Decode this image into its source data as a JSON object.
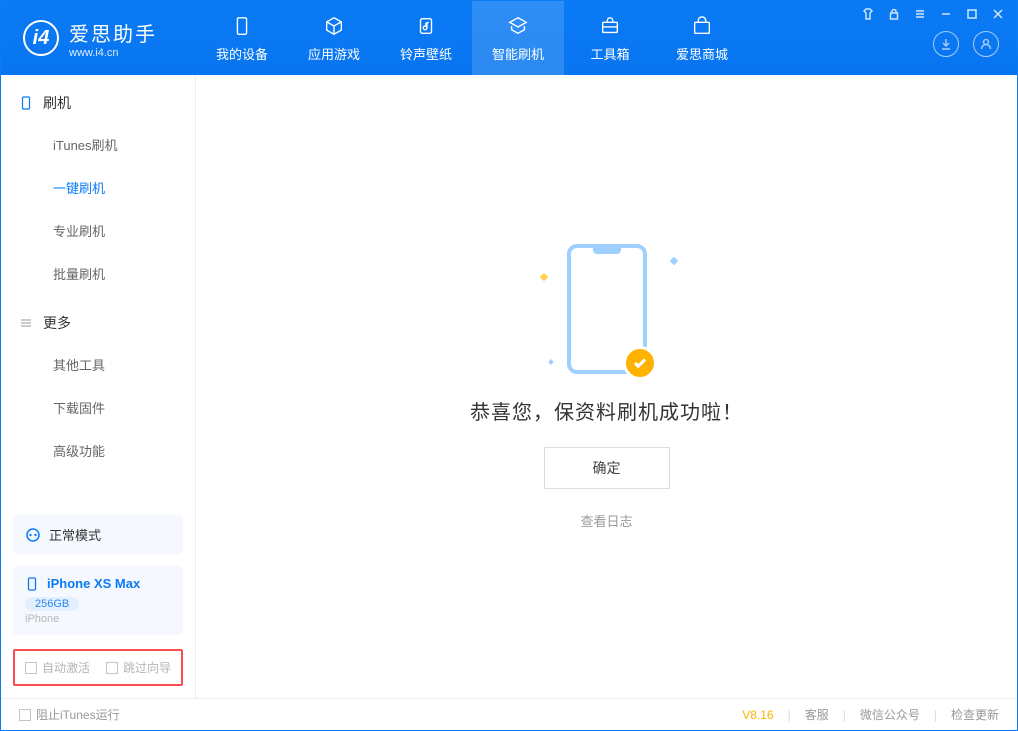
{
  "app": {
    "name": "爱思助手",
    "url": "www.i4.cn"
  },
  "nav": {
    "tabs": [
      {
        "label": "我的设备",
        "icon": "device"
      },
      {
        "label": "应用游戏",
        "icon": "cube"
      },
      {
        "label": "铃声壁纸",
        "icon": "music"
      },
      {
        "label": "智能刷机",
        "icon": "refresh"
      },
      {
        "label": "工具箱",
        "icon": "toolbox"
      },
      {
        "label": "爱思商城",
        "icon": "shop"
      }
    ]
  },
  "sidebar": {
    "group_flash": "刷机",
    "items_flash": [
      "iTunes刷机",
      "一键刷机",
      "专业刷机",
      "批量刷机"
    ],
    "group_more": "更多",
    "items_more": [
      "其他工具",
      "下载固件",
      "高级功能"
    ]
  },
  "mode_card": {
    "label": "正常模式"
  },
  "device_card": {
    "name": "iPhone XS Max",
    "storage": "256GB",
    "type": "iPhone"
  },
  "bottom_opts": {
    "opt1": "自动激活",
    "opt2": "跳过向导"
  },
  "main": {
    "success": "恭喜您，保资料刷机成功啦！",
    "ok": "确定",
    "view_log": "查看日志"
  },
  "status": {
    "block_itunes": "阻止iTunes运行",
    "version": "V8.16",
    "links": [
      "客服",
      "微信公众号",
      "检查更新"
    ]
  }
}
